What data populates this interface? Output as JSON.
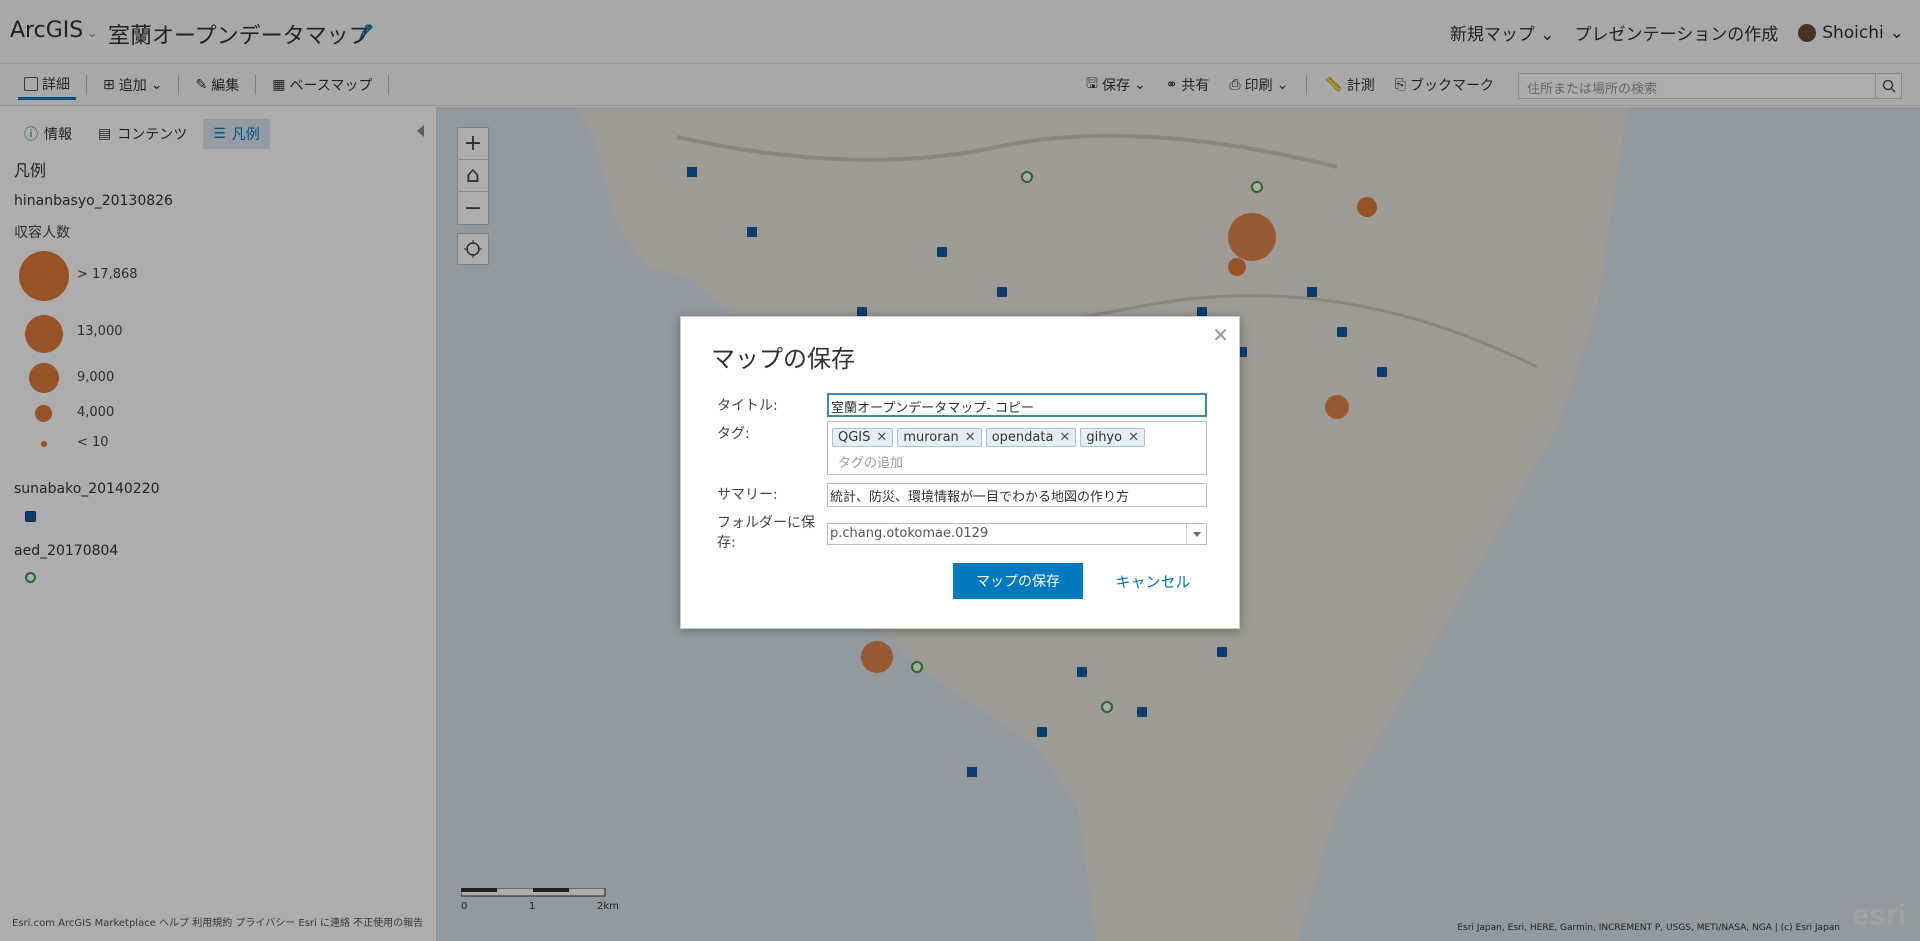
{
  "topbar": {
    "brand": "ArcGIS",
    "map_title": "室蘭オープンデータマップ",
    "new_map": "新規マップ",
    "create_presentation": "プレゼンテーションの作成",
    "user": "Shoichi"
  },
  "toolbar": {
    "details": "詳細",
    "add": "追加",
    "edit": "編集",
    "basemap": "ベースマップ",
    "save": "保存",
    "share": "共有",
    "print": "印刷",
    "measure": "計測",
    "bookmarks": "ブックマーク",
    "search_placeholder": "住所または場所の検索"
  },
  "sidebar": {
    "tabs": [
      {
        "label": "情報"
      },
      {
        "label": "コンテンツ"
      },
      {
        "label": "凡例"
      }
    ],
    "legend_title": "凡例",
    "layers": [
      {
        "name": "hinanbasyo_20130826",
        "field": "収容人数",
        "classes": [
          "> 17,868",
          "13,000",
          "9,000",
          "4,000",
          "< 10"
        ]
      },
      {
        "name": "sunabako_20140220"
      },
      {
        "name": "aed_20170804"
      }
    ],
    "footer": "Esri.com ArcGIS Marketplace ヘルプ 利用規約 プライバシー Esri に連絡 不正使用の報告"
  },
  "map": {
    "scale_labels": [
      "0",
      "1",
      "2km"
    ],
    "attribution": "Esri Japan, Esri, HERE, Garmin, INCREMENT P, USGS, METI/NASA, NGA | (c) Esri Japan",
    "logo": "esri"
  },
  "dialog": {
    "title": "マップの保存",
    "title_label": "タイトル:",
    "title_value": "室蘭オープンデータマップ- コピー",
    "tags_label": "タグ:",
    "tags": [
      "QGIS",
      "muroran",
      "opendata",
      "gihyo"
    ],
    "tag_add_placeholder": "タグの追加",
    "summary_label": "サマリー:",
    "summary_value": "統計、防災、環境情報が一目でわかる地図の作り方",
    "folder_label": "フォルダーに保存:",
    "folder_value": "p.chang.otokomae.0129",
    "save_button": "マップの保存",
    "cancel_button": "キャンセル"
  },
  "colors": {
    "accent": "#0079c1",
    "shelter": "#e07a3a",
    "sandbox": "#135aa0",
    "aed": "#3e9a3e"
  }
}
